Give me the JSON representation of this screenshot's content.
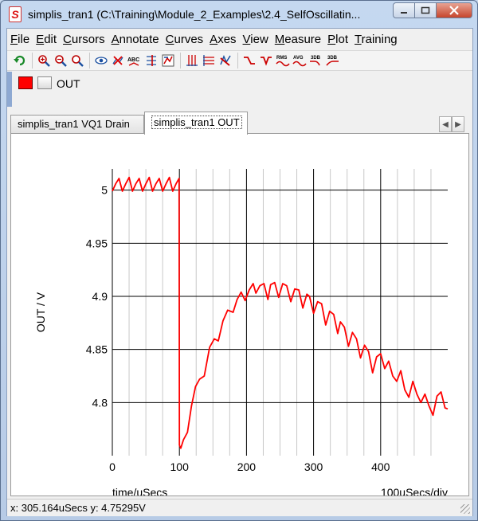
{
  "window": {
    "title": "simplis_tran1 (C:\\Training\\Module_2_Examples\\2.4_SelfOscillatin...",
    "app_icon": "simplis-logo-icon"
  },
  "menubar": {
    "items": [
      "File",
      "Edit",
      "Cursors",
      "Annotate",
      "Curves",
      "Axes",
      "View",
      "Measure",
      "Plot",
      "Training"
    ]
  },
  "toolbar": {
    "group1": [
      "undo-icon"
    ],
    "group2": [
      "zoom-in-icon",
      "zoom-out-icon",
      "zoom-fit-icon"
    ],
    "group3": [
      "eye-icon",
      "delete-curve-icon",
      "abc-label-icon",
      "add-grid-icon",
      "curve-props-icon"
    ],
    "group4": [
      "grid-vertical-icon",
      "grid-horizontal-icon",
      "curve-style-icon"
    ],
    "group5": [
      {
        "icon": "falling-edge-icon",
        "label": ""
      },
      {
        "icon": "rising-edge-icon",
        "label": ""
      },
      {
        "icon": "rms-icon",
        "label": "RMS"
      },
      {
        "icon": "avg-icon",
        "label": "AVG"
      },
      {
        "icon": "db-icon",
        "label": "3DB"
      },
      {
        "icon": "db2-icon",
        "label": "3DB"
      }
    ]
  },
  "legend": {
    "curve_label": "OUT",
    "curve_color": "#ff0000"
  },
  "tabs": [
    {
      "label": "simplis_tran1 VQ1 Drain",
      "active": false
    },
    {
      "label": "simplis_tran1 OUT",
      "active": true
    }
  ],
  "statusbar": {
    "text": "x: 305.164uSecs  y: 4.75295V"
  },
  "chart_data": {
    "type": "line",
    "xlabel": "time/uSecs",
    "ylabel": "OUT / V",
    "x_div_label": "100uSecs/div",
    "xlim": [
      0,
      500
    ],
    "ylim": [
      4.75,
      5.02
    ],
    "x_ticks": [
      0,
      100,
      200,
      300,
      400
    ],
    "y_ticks": [
      4.8,
      4.85,
      4.9,
      4.95,
      5
    ],
    "y_tick_labels": [
      "4.8",
      "4.85",
      "4.9",
      "4.95",
      "5"
    ],
    "grid": true,
    "series": [
      {
        "name": "",
        "color": "#ff0000",
        "x": [
          0,
          5,
          10,
          15,
          20,
          25,
          30,
          35,
          40,
          45,
          50,
          55,
          60,
          65,
          70,
          75,
          80,
          85,
          90,
          95,
          99.5,
          100,
          102,
          106,
          112,
          118,
          124,
          130,
          137,
          145,
          152,
          158,
          165,
          172,
          180,
          186,
          192,
          198,
          204,
          210,
          214,
          220,
          226,
          232,
          236,
          242,
          248,
          254,
          260,
          266,
          272,
          278,
          284,
          290,
          294,
          300,
          306,
          312,
          318,
          324,
          330,
          336,
          340,
          346,
          352,
          358,
          364,
          370,
          376,
          382,
          388,
          394,
          400,
          406,
          412,
          418,
          424,
          430,
          436,
          442,
          448,
          454,
          460,
          466,
          472,
          478,
          484,
          490,
          496,
          500
        ],
        "y": [
          4.999,
          5.006,
          5.011,
          4.999,
          5.006,
          5.012,
          4.999,
          5.006,
          5.011,
          4.999,
          5.006,
          5.012,
          4.999,
          5.006,
          5.011,
          4.999,
          5.006,
          5.012,
          4.999,
          5.006,
          5.011,
          4.76,
          4.757,
          4.765,
          4.772,
          4.797,
          4.815,
          4.822,
          4.825,
          4.852,
          4.86,
          4.858,
          4.877,
          4.887,
          4.885,
          4.897,
          4.904,
          4.896,
          4.906,
          4.912,
          4.903,
          4.91,
          4.912,
          4.897,
          4.911,
          4.913,
          4.899,
          4.912,
          4.91,
          4.895,
          4.907,
          4.906,
          4.889,
          4.902,
          4.9,
          4.884,
          4.895,
          4.893,
          4.873,
          4.886,
          4.883,
          4.865,
          4.876,
          4.871,
          4.853,
          4.866,
          4.86,
          4.842,
          4.854,
          4.848,
          4.828,
          4.843,
          4.846,
          4.832,
          4.839,
          4.825,
          4.82,
          4.83,
          4.812,
          4.805,
          4.82,
          4.808,
          4.8,
          4.808,
          4.797,
          4.788,
          4.806,
          4.81,
          4.795,
          4.794
        ]
      }
    ]
  }
}
